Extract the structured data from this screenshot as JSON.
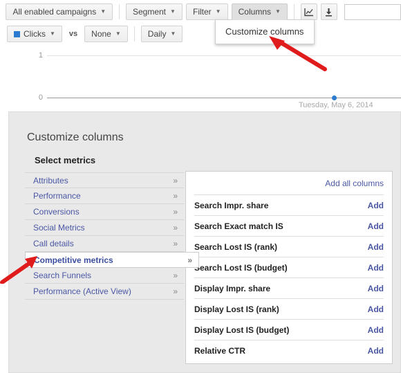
{
  "toolbar": {
    "campaign_selector": "All enabled campaigns",
    "segment": "Segment",
    "filter": "Filter",
    "columns": "Columns",
    "chart_icon_name": "line-chart-icon",
    "download_icon_name": "download-icon",
    "search_placeholder": "",
    "search_value": "",
    "metric_primary": "Clicks",
    "vs": "vs",
    "metric_secondary": "None",
    "granularity": "Daily",
    "caret": "▼"
  },
  "dropdown": {
    "items": [
      {
        "label": "Customize columns"
      }
    ]
  },
  "chart_data": {
    "type": "line",
    "title": "",
    "xlabel": "",
    "ylabel": "",
    "categories": [
      "Tuesday, May 6, 2014"
    ],
    "values": [
      0
    ],
    "ytick_labels": [
      "1",
      "0"
    ],
    "ylim": [
      0,
      1
    ],
    "grid": true,
    "legend": "Clicks",
    "point_color": "#2b7bd0",
    "annotations": [
      "Tuesday, May 6, 2014"
    ]
  },
  "panel": {
    "title": "Customize columns",
    "section_title": "Select metrics",
    "chevron": "»",
    "categories": [
      {
        "label": "Attributes",
        "selected": false
      },
      {
        "label": "Performance",
        "selected": false
      },
      {
        "label": "Conversions",
        "selected": false
      },
      {
        "label": "Social Metrics",
        "selected": false
      },
      {
        "label": "Call details",
        "selected": false
      },
      {
        "label": "Competitive metrics",
        "selected": true
      },
      {
        "label": "Search Funnels",
        "selected": false
      },
      {
        "label": "Performance (Active View)",
        "selected": false
      }
    ],
    "metrics_header_link": "Add all columns",
    "metrics": [
      {
        "name": "Search Impr. share",
        "action": "Add"
      },
      {
        "name": "Search Exact match IS",
        "action": "Add"
      },
      {
        "name": "Search Lost IS (rank)",
        "action": "Add"
      },
      {
        "name": "Search Lost IS (budget)",
        "action": "Add"
      },
      {
        "name": "Display Impr. share",
        "action": "Add"
      },
      {
        "name": "Display Lost IS (rank)",
        "action": "Add"
      },
      {
        "name": "Display Lost IS (budget)",
        "action": "Add"
      },
      {
        "name": "Relative CTR",
        "action": "Add"
      }
    ]
  },
  "annotations": {
    "arrow_color": "#e01b1b",
    "arrow_1_target": "Customize columns",
    "arrow_2_target": "Competitive metrics"
  }
}
